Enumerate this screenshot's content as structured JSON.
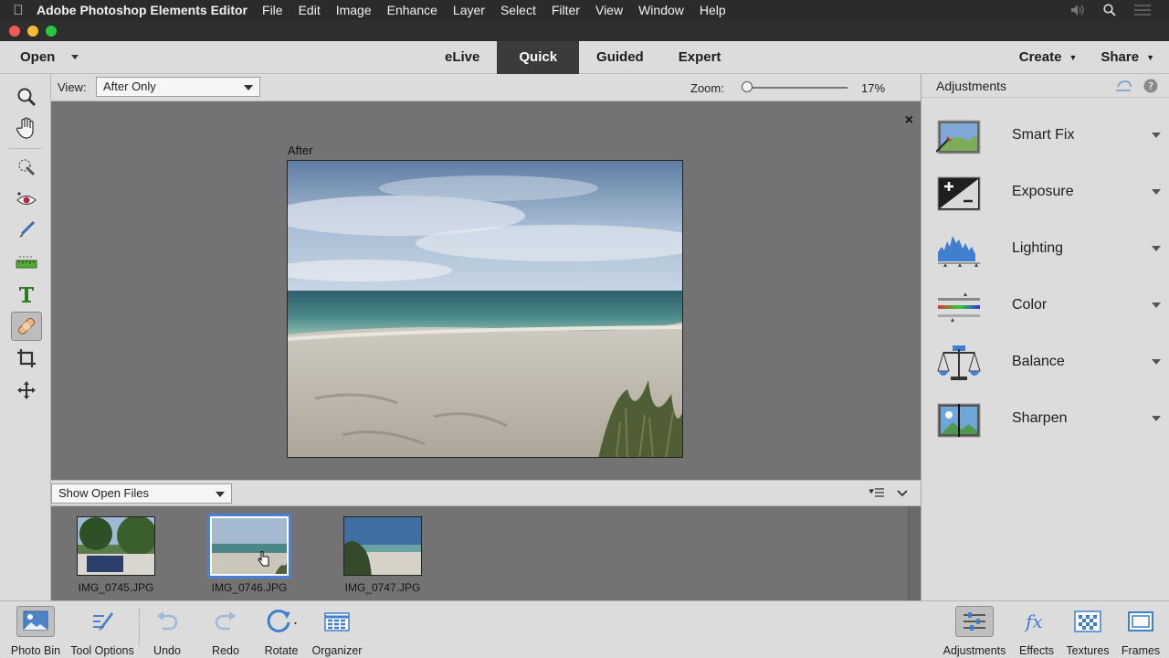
{
  "menubar": {
    "app_name": "Adobe Photoshop Elements Editor",
    "menus": [
      "File",
      "Edit",
      "Image",
      "Enhance",
      "Layer",
      "Select",
      "Filter",
      "View",
      "Window",
      "Help"
    ]
  },
  "modebar": {
    "open_label": "Open",
    "modes": [
      "eLive",
      "Quick",
      "Guided",
      "Expert"
    ],
    "active_mode": "Quick",
    "create_label": "Create",
    "share_label": "Share"
  },
  "viewbar": {
    "view_label": "View:",
    "view_value": "After Only",
    "zoom_label": "Zoom:",
    "zoom_value": "17%",
    "zoom_level": 0.0
  },
  "canvas": {
    "image_caption": "After",
    "close_glyph": "×"
  },
  "bin": {
    "dropdown_value": "Show Open Files",
    "files": [
      {
        "name": "IMG_0745.JPG",
        "selected": false
      },
      {
        "name": "IMG_0746.JPG",
        "selected": true
      },
      {
        "name": "IMG_0747.JPG",
        "selected": false
      }
    ]
  },
  "panel": {
    "title": "Adjustments",
    "items": [
      {
        "label": "Smart Fix",
        "icon": "smart-fix-icon"
      },
      {
        "label": "Exposure",
        "icon": "exposure-icon"
      },
      {
        "label": "Lighting",
        "icon": "lighting-icon"
      },
      {
        "label": "Color",
        "icon": "color-icon"
      },
      {
        "label": "Balance",
        "icon": "balance-icon"
      },
      {
        "label": "Sharpen",
        "icon": "sharpen-icon"
      }
    ]
  },
  "bottombar": {
    "left": [
      {
        "label": "Photo Bin",
        "icon": "photo-bin-icon"
      },
      {
        "label": "Tool Options",
        "icon": "tool-options-icon"
      },
      {
        "label": "Undo",
        "icon": "undo-icon"
      },
      {
        "label": "Redo",
        "icon": "redo-icon"
      },
      {
        "label": "Rotate",
        "icon": "rotate-icon"
      },
      {
        "label": "Organizer",
        "icon": "organizer-icon"
      }
    ],
    "right": [
      {
        "label": "Adjustments",
        "icon": "adjustments-icon"
      },
      {
        "label": "Effects",
        "icon": "effects-icon"
      },
      {
        "label": "Textures",
        "icon": "textures-icon"
      },
      {
        "label": "Frames",
        "icon": "frames-icon"
      }
    ]
  },
  "colors": {
    "accent_selected": "#4b7fd6",
    "active_mode_bg": "#3b3b3b"
  }
}
